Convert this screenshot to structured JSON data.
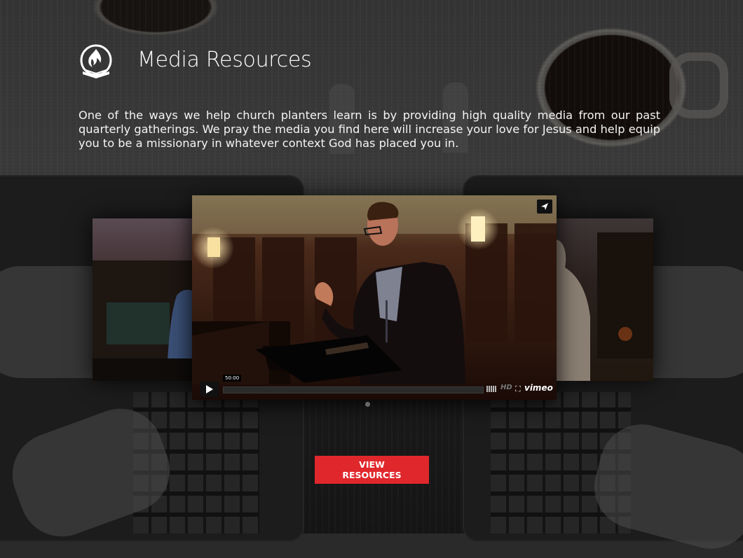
{
  "header": {
    "title": "Media Resources",
    "logo_icon": "flame-book-icon"
  },
  "intro": {
    "text": "One of the ways we help church planters learn is by providing high quality media from our past quarterly gatherings. We pray the media you find here will increase your love for Jesus and help equip you to be a missionary in whatever context God has placed you in."
  },
  "player": {
    "time": "50:00",
    "hd_label": "HD",
    "brand": "vimeo",
    "fullscreen_glyph": "⛶",
    "icons": [
      "play-icon",
      "share-icon",
      "volume-icon",
      "fullscreen-icon"
    ]
  },
  "cta": {
    "label": "VIEW\nRESOURCES",
    "color": "#e0272c"
  },
  "colors": {
    "accent": "#e0272c",
    "background": "#2a2a2a",
    "text": "#ffffff"
  }
}
